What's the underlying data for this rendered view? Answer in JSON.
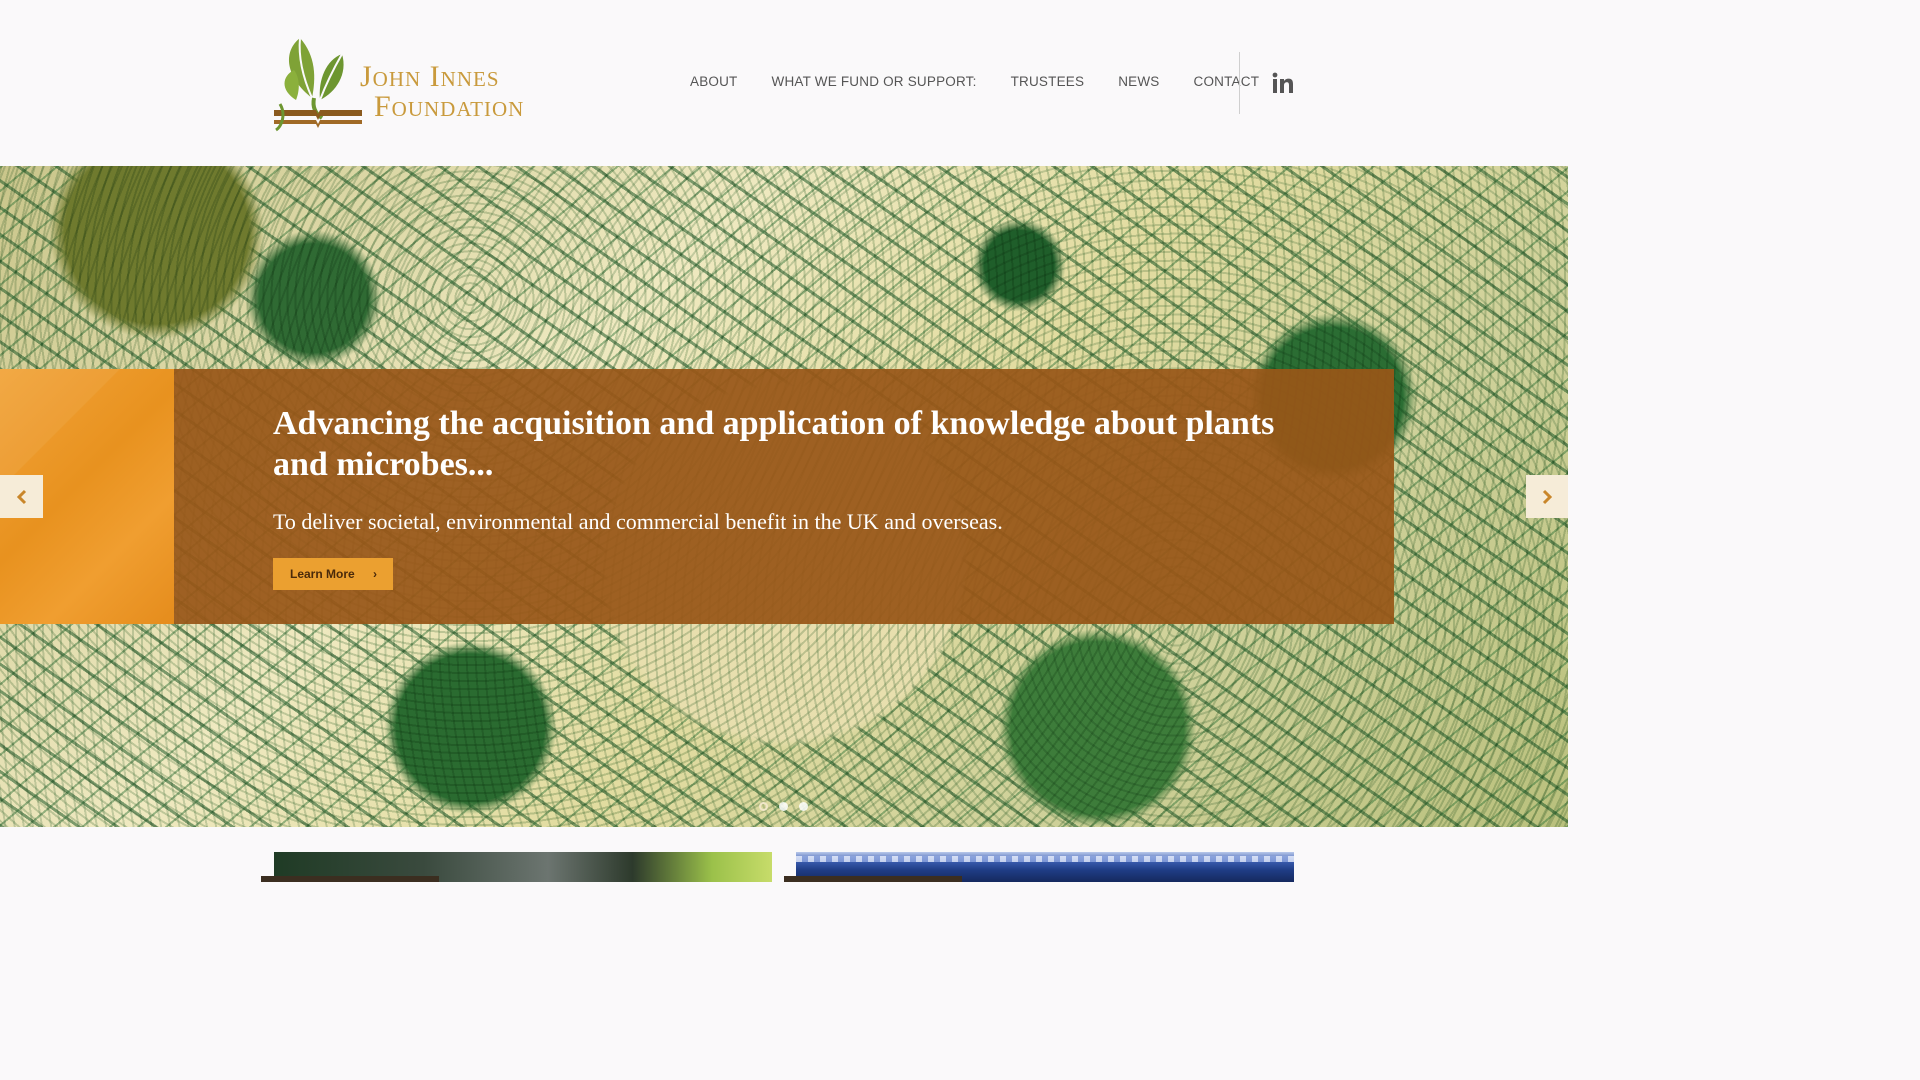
{
  "site": {
    "logo": {
      "line1": "John Innes",
      "line2": "Foundation"
    },
    "nav": [
      {
        "label": "ABOUT"
      },
      {
        "label": "WHAT WE FUND OR SUPPORT:"
      },
      {
        "label": "TRUSTEES"
      },
      {
        "label": "NEWS"
      },
      {
        "label": "CONTACT"
      }
    ],
    "social": {
      "icon": "linkedin-icon"
    }
  },
  "hero": {
    "title": "Advancing the acquisition and application of knowledge about plants and microbes...",
    "subtitle": "To deliver societal, environmental and commercial benefit in the UK and overseas.",
    "button_label": "Learn More",
    "slides_total": 3,
    "active_slide": 1
  },
  "colors": {
    "brand_gold": "#c99a3c",
    "brand_green": "#6f9a2e",
    "banner_brown": "#985618",
    "accent_orange": "#eba030"
  }
}
